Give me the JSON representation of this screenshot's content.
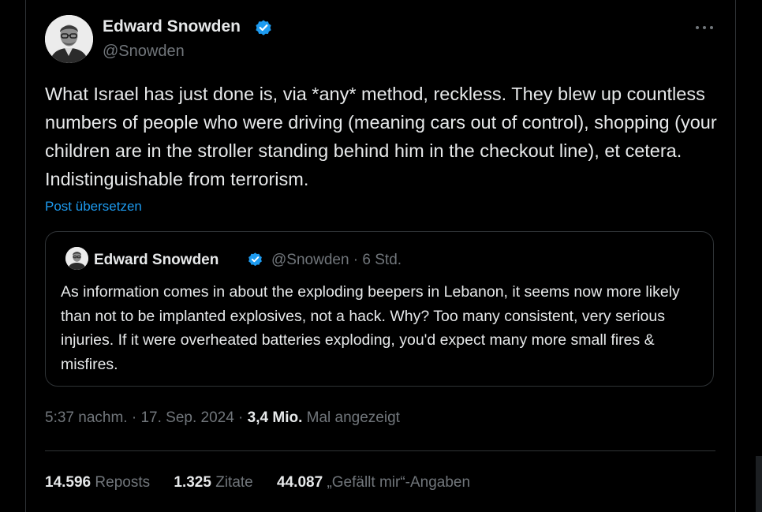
{
  "tweet": {
    "author_name": "Edward Snowden",
    "handle": "@Snowden",
    "avatar_icon": "snowden-portrait",
    "verified_color": "#1d9bf0",
    "text": "What Israel has just done is, via *any* method, reckless. They blew up countless numbers of people who were driving (meaning cars out of control), shopping (your children are in the stroller standing behind him in the checkout line), et cetera. Indistinguishable from terrorism.",
    "translate_label": "Post übersetzen"
  },
  "quoted": {
    "author_name": "Edward Snowden",
    "handle_time": "@Snowden · 6 Std.",
    "text": "As information comes in about the exploding beepers in Lebanon, it seems now more likely than not to be implanted explosives, not a hack. Why? Too many consistent, very serious injuries. If it were overheated batteries exploding, you'd expect many more small fires & misfires."
  },
  "meta": {
    "timestamp": "5:37 nachm. · 17. Sep. 2024 · ",
    "views_count": "3,4 Mio.",
    "views_label": " Mal angezeigt"
  },
  "stats": {
    "reposts_count": "14.596",
    "reposts_label": "Reposts",
    "quotes_count": "1.325",
    "quotes_label": "Zitate",
    "likes_count": "44.087",
    "likes_label": "„Gefällt mir“-Angaben"
  },
  "colors": {
    "background": "#000000",
    "text": "#e7e9ea",
    "muted": "#71767b",
    "link": "#1d9bf0",
    "border": "#2f3336"
  }
}
